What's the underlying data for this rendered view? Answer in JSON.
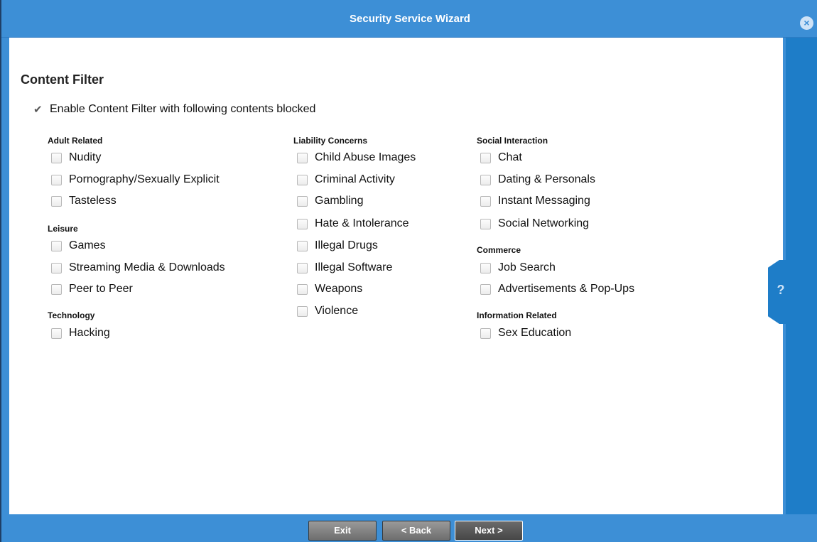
{
  "window": {
    "title": "Security Service Wizard",
    "close_glyph": "×"
  },
  "help": {
    "glyph": "?"
  },
  "page": {
    "heading": "Content Filter",
    "enable_label": "Enable Content Filter with following contents blocked",
    "enable_checked": true
  },
  "groups": {
    "adult": {
      "title": "Adult Related",
      "items": [
        "Nudity",
        "Pornography/Sexually Explicit",
        "Tasteless"
      ]
    },
    "leisure": {
      "title": "Leisure",
      "items": [
        "Games",
        "Streaming Media & Downloads",
        "Peer to Peer"
      ]
    },
    "technology": {
      "title": "Technology",
      "items": [
        "Hacking"
      ]
    },
    "liability": {
      "title": "Liability Concerns",
      "items": [
        "Child Abuse Images",
        "Criminal Activity",
        "Gambling",
        "Hate & Intolerance",
        "Illegal Drugs",
        "Illegal Software",
        "Weapons",
        "Violence"
      ]
    },
    "social": {
      "title": "Social Interaction",
      "items": [
        "Chat",
        "Dating & Personals",
        "Instant Messaging",
        "Social Networking"
      ]
    },
    "commerce": {
      "title": "Commerce",
      "items": [
        "Job Search",
        "Advertisements & Pop-Ups"
      ]
    },
    "information": {
      "title": "Information Related",
      "items": [
        "Sex Education"
      ]
    }
  },
  "footer": {
    "exit_label": "Exit",
    "back_label": "< Back",
    "next_label": "Next >"
  },
  "colors": {
    "chrome_blue": "#3d8fd6",
    "help_blue": "#1e7dc8",
    "button_gray": "#7f7f7f"
  }
}
